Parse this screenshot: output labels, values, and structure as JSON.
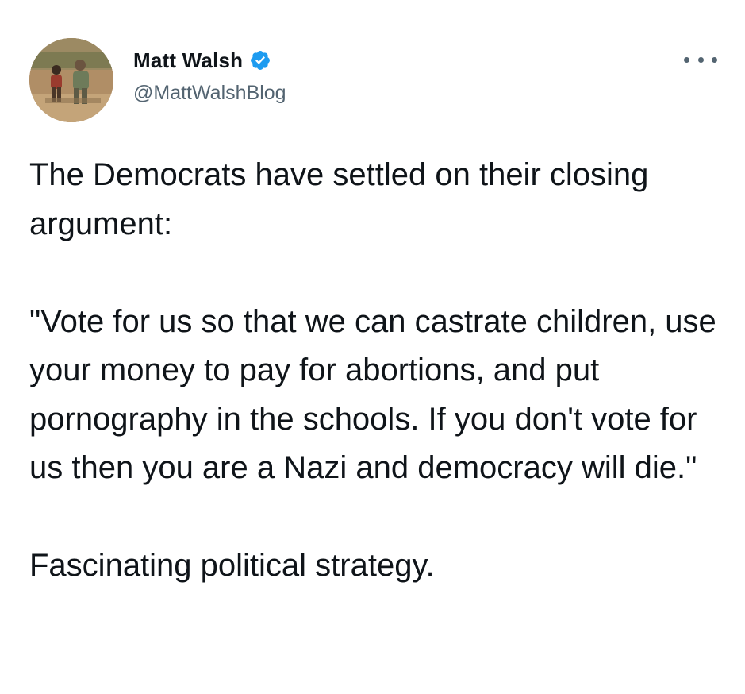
{
  "author": {
    "display_name": "Matt Walsh",
    "handle": "@MattWalshBlog",
    "verified": true,
    "avatar_icon": "profile-photo"
  },
  "menu": {
    "icon": "more-options-icon"
  },
  "tweet": {
    "paragraphs": [
      "The Democrats have settled on their closing argument:",
      "\"Vote for us so that we can castrate children, use your money to pay for abortions, and put pornography in the schools. If you don't vote for us then you are a Nazi and democracy will die.\"",
      "Fascinating political strategy."
    ]
  },
  "colors": {
    "text": "#0f1419",
    "secondary": "#536471",
    "verified_badge": "#1d9bf0"
  }
}
